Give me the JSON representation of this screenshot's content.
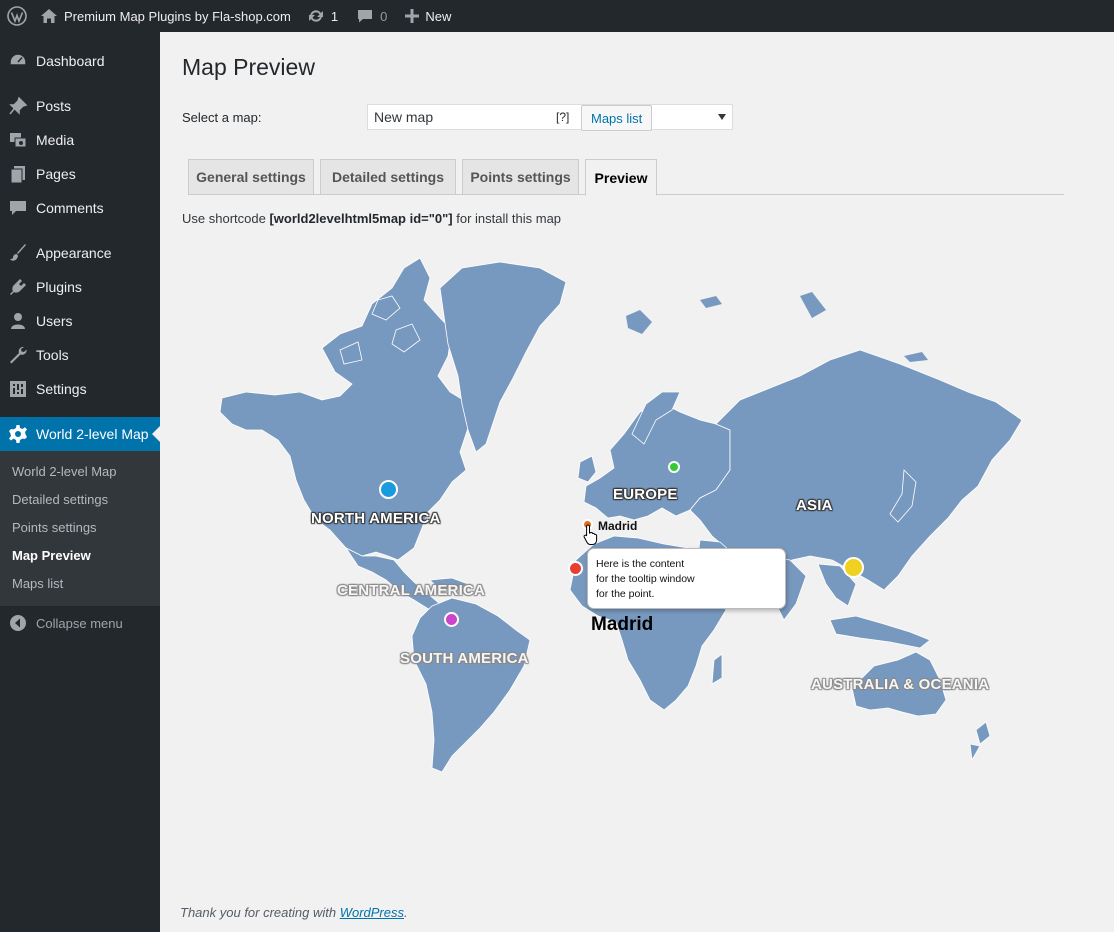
{
  "admin_bar": {
    "site_name": "Premium Map Plugins by Fla-shop.com",
    "updates_count": "1",
    "comments_count": "0",
    "new_label": "New"
  },
  "menu": {
    "items": [
      {
        "label": "Dashboard",
        "icon": "dashboard-icon"
      },
      {
        "label": "Posts",
        "icon": "pin-icon"
      },
      {
        "label": "Media",
        "icon": "media-icon"
      },
      {
        "label": "Pages",
        "icon": "pages-icon"
      },
      {
        "label": "Comments",
        "icon": "comment-icon"
      },
      {
        "label": "Appearance",
        "icon": "brush-icon"
      },
      {
        "label": "Plugins",
        "icon": "plug-icon"
      },
      {
        "label": "Users",
        "icon": "user-icon"
      },
      {
        "label": "Tools",
        "icon": "wrench-icon"
      },
      {
        "label": "Settings",
        "icon": "settings-icon"
      },
      {
        "label": "World 2-level Map",
        "icon": "gear-icon"
      }
    ],
    "submenu": [
      {
        "label": "World 2-level Map"
      },
      {
        "label": "Detailed settings"
      },
      {
        "label": "Points settings"
      },
      {
        "label": "Map Preview"
      },
      {
        "label": "Maps list"
      }
    ],
    "collapse_label": "Collapse menu"
  },
  "page": {
    "title": "Map Preview",
    "select_label": "Select a map:",
    "selected_map": "New map",
    "help": "[?]",
    "maps_list_button": "Maps list",
    "tabs": [
      {
        "label": "General settings"
      },
      {
        "label": "Detailed settings"
      },
      {
        "label": "Points settings"
      },
      {
        "label": "Preview"
      }
    ],
    "shortcode_prefix": "Use shortcode",
    "shortcode": "[world2levelhtml5map id=\"0\"]",
    "shortcode_suffix": "for install this map"
  },
  "map": {
    "land_color": "#7899bf",
    "regions": [
      {
        "label": "NORTH AMERICA"
      },
      {
        "label": "CENTRAL AMERICA"
      },
      {
        "label": "SOUTH AMERICA"
      },
      {
        "label": "EUROPE"
      },
      {
        "label": "ASIA"
      },
      {
        "label": "AUSTRALIA & OCEANIA"
      }
    ],
    "points": [
      {
        "color": "#1a9be0",
        "icon": "point-blue"
      },
      {
        "color": "#33cc33",
        "icon": "point-green"
      },
      {
        "color": "#e07020",
        "icon": "point-orange"
      },
      {
        "color": "#e84030",
        "icon": "point-red"
      },
      {
        "color": "#cc44cc",
        "icon": "point-magenta"
      },
      {
        "color": "#f0d020",
        "icon": "point-yellow"
      }
    ],
    "point_label": "Madrid",
    "highlight_label": "Madrid",
    "tooltip": {
      "line1": "Here is the content",
      "line2": "for the tooltip window",
      "line3": "for the point."
    }
  },
  "footer": {
    "prefix": "Thank you for creating with",
    "link": "WordPress",
    "suffix": "."
  }
}
